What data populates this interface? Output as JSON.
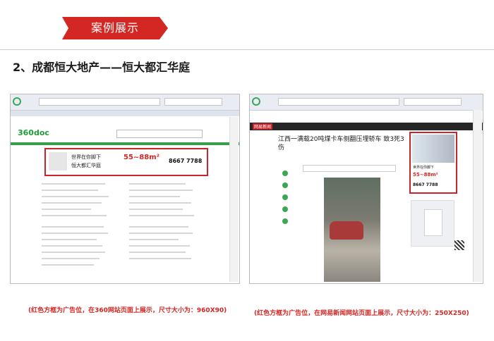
{
  "banner": {
    "label": "案例展示"
  },
  "section": {
    "heading": "2、成都恒大地产——恒大都汇华庭"
  },
  "left_shot": {
    "site_logo": "360doc",
    "ad": {
      "slogan1": "世界在你脚下",
      "slogan2": "恒大都汇华庭",
      "price": "55~88m²",
      "phone": "8667 7788"
    },
    "caption": "(红色方框为广告位，在360网站页面上展示，尺寸大小为：960X90)"
  },
  "right_shot": {
    "site_logo": "网易新闻",
    "headline": "江西一满载20吨煤卡车侧翻压埋轿车 致3死3伤",
    "ad": {
      "slogan": "世界在你脚下",
      "price": "55~88m²",
      "phone": "8667 7788"
    },
    "caption": "(红色方框为广告位，在网易新闻网站页面上展示，尺寸大小为：250X250)"
  },
  "colors": {
    "accent": "#d32723",
    "ad_border": "#c9232b"
  }
}
